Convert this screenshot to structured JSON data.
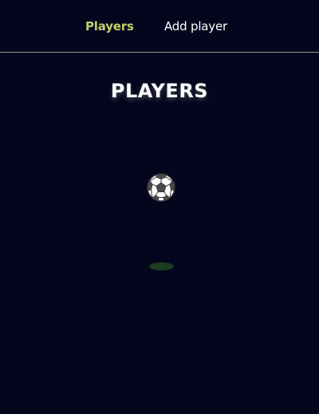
{
  "nav": {
    "items": [
      {
        "label": "Players",
        "active": true
      },
      {
        "label": "Add player",
        "active": false
      }
    ],
    "active_color": "#c2d06a",
    "divider_color": "#9b9b86"
  },
  "main": {
    "title": "PLAYERS",
    "loader_icon": "soccer-ball-icon"
  },
  "colors": {
    "background": "#03061c",
    "text": "#ffffff",
    "shadow": "#1b3d20"
  }
}
